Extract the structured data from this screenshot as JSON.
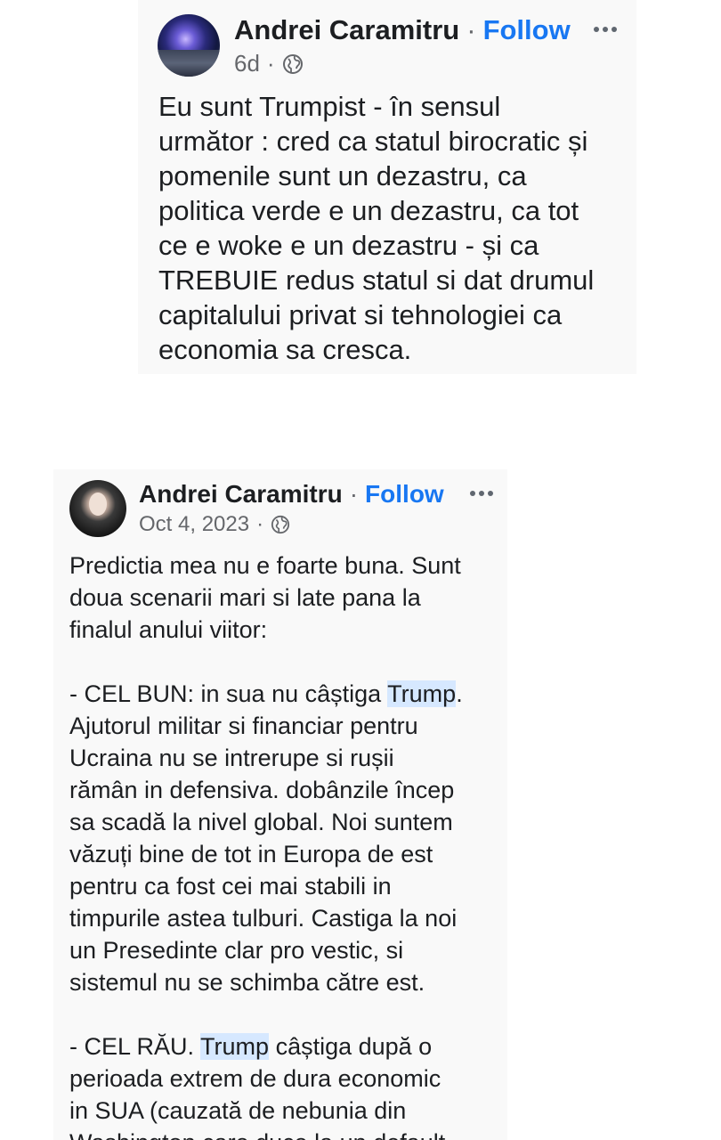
{
  "post1": {
    "author": "Andrei Caramitru",
    "separator": "·",
    "follow_label": "Follow",
    "time": "6d",
    "meta_separator": "·",
    "privacy_icon": "globe-icon",
    "more_icon": "more-options-icon",
    "body": "Eu sunt Trumpist - în sensul\nurmător : cred ca statul birocratic și\npomenile sunt un dezastru, ca\npolitica verde e un dezastru, ca tot\nce e woke e un dezastru - și ca\nTREBUIE redus statul si dat drumul\ncapitalului privat si tehnologiei ca\neconomia sa cresca."
  },
  "post2": {
    "author": "Andrei Caramitru",
    "separator": "·",
    "follow_label": "Follow",
    "time": "Oct 4, 2023",
    "meta_separator": "·",
    "privacy_icon": "globe-icon",
    "more_icon": "more-options-icon",
    "highlight_word": "Trump",
    "para1": "Predictia mea nu e foarte buna. Sunt\ndoua scenarii mari si late pana la\nfinalul anului viitor:",
    "para2_before": "- CEL BUN: in sua nu câștiga ",
    "para2_after": ".\nAjutorul militar si financiar pentru\nUcraina nu se intrerupe si rușii\nrămân in defensiva. dobânzile încep\nsa scadă la nivel global. Noi suntem\nvăzuți bine de tot in Europa de est\npentru ca fost cei mai stabili in\ntimpurile astea tulburi. Castiga la noi\nun Presedinte clar pro vestic, si\nsistemul nu se schimba către est.",
    "para3_before": "- CEL RĂU. ",
    "para3_after": " câștiga după o\nperioada extrem de dura economic\nin SUA (cauzată de nebunia din\nWashington care duce la un default"
  },
  "colors": {
    "follow": "#1877f2",
    "secondary_text": "#65676b",
    "highlight": "#d6e8ff",
    "card_background": "#f9f9f9"
  }
}
